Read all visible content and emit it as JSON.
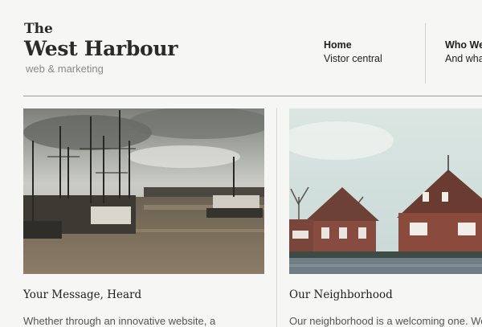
{
  "brand": {
    "line1": "The",
    "line2": "West Harbour",
    "tagline": "web & marketing"
  },
  "nav": [
    {
      "title": "Home",
      "subtitle": "Vistor central"
    },
    {
      "title": "Who We",
      "subtitle": "And wha"
    }
  ],
  "cards": [
    {
      "image": "harbor-fishing-boats-photo",
      "title": "Your Message, Heard",
      "text": "Whether through an innovative website, a"
    },
    {
      "image": "canal-brick-houses-photo",
      "title": "Our Neighborhood",
      "text": "Our neighborhood is a welcoming one. We"
    }
  ]
}
